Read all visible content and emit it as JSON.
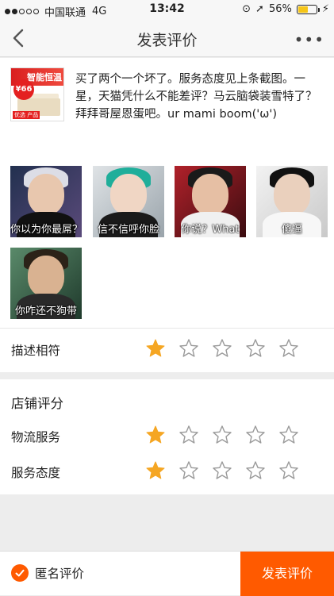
{
  "status_bar": {
    "carrier": "中国联通",
    "network": "4G",
    "time": "13:42",
    "battery": "56%",
    "battery_level": 0.56
  },
  "nav": {
    "title": "发表评价"
  },
  "review": {
    "product_thumb": {
      "brand": "智能恒温",
      "price": "¥66",
      "footer": "优选 产品"
    },
    "text": "买了两个一个坏了。服务态度见上条截图。一星，天猫凭什么不能差评？马云脑袋装雪特了？拜拜哥屋恩蛋吧。ur mami boom('ω')",
    "photos": [
      {
        "caption": "你以为你最屌？"
      },
      {
        "caption": "信不信呼你脸"
      },
      {
        "caption": "你说？What"
      },
      {
        "caption": "傻逼"
      },
      {
        "caption": "你咋还不狗带"
      }
    ]
  },
  "description_rating": {
    "label": "描述相符",
    "rating": 1,
    "max": 5
  },
  "shop_rating": {
    "heading": "店铺评分",
    "items": [
      {
        "label": "物流服务",
        "rating": 1,
        "max": 5
      },
      {
        "label": "服务态度",
        "rating": 1,
        "max": 5
      }
    ]
  },
  "bottom": {
    "anonymous_label": "匿名评价",
    "anonymous_checked": true,
    "submit_label": "发表评价"
  },
  "colors": {
    "accent": "#ff5a00",
    "star_filled": "#f5a623",
    "star_empty": "#9a9a9a"
  }
}
